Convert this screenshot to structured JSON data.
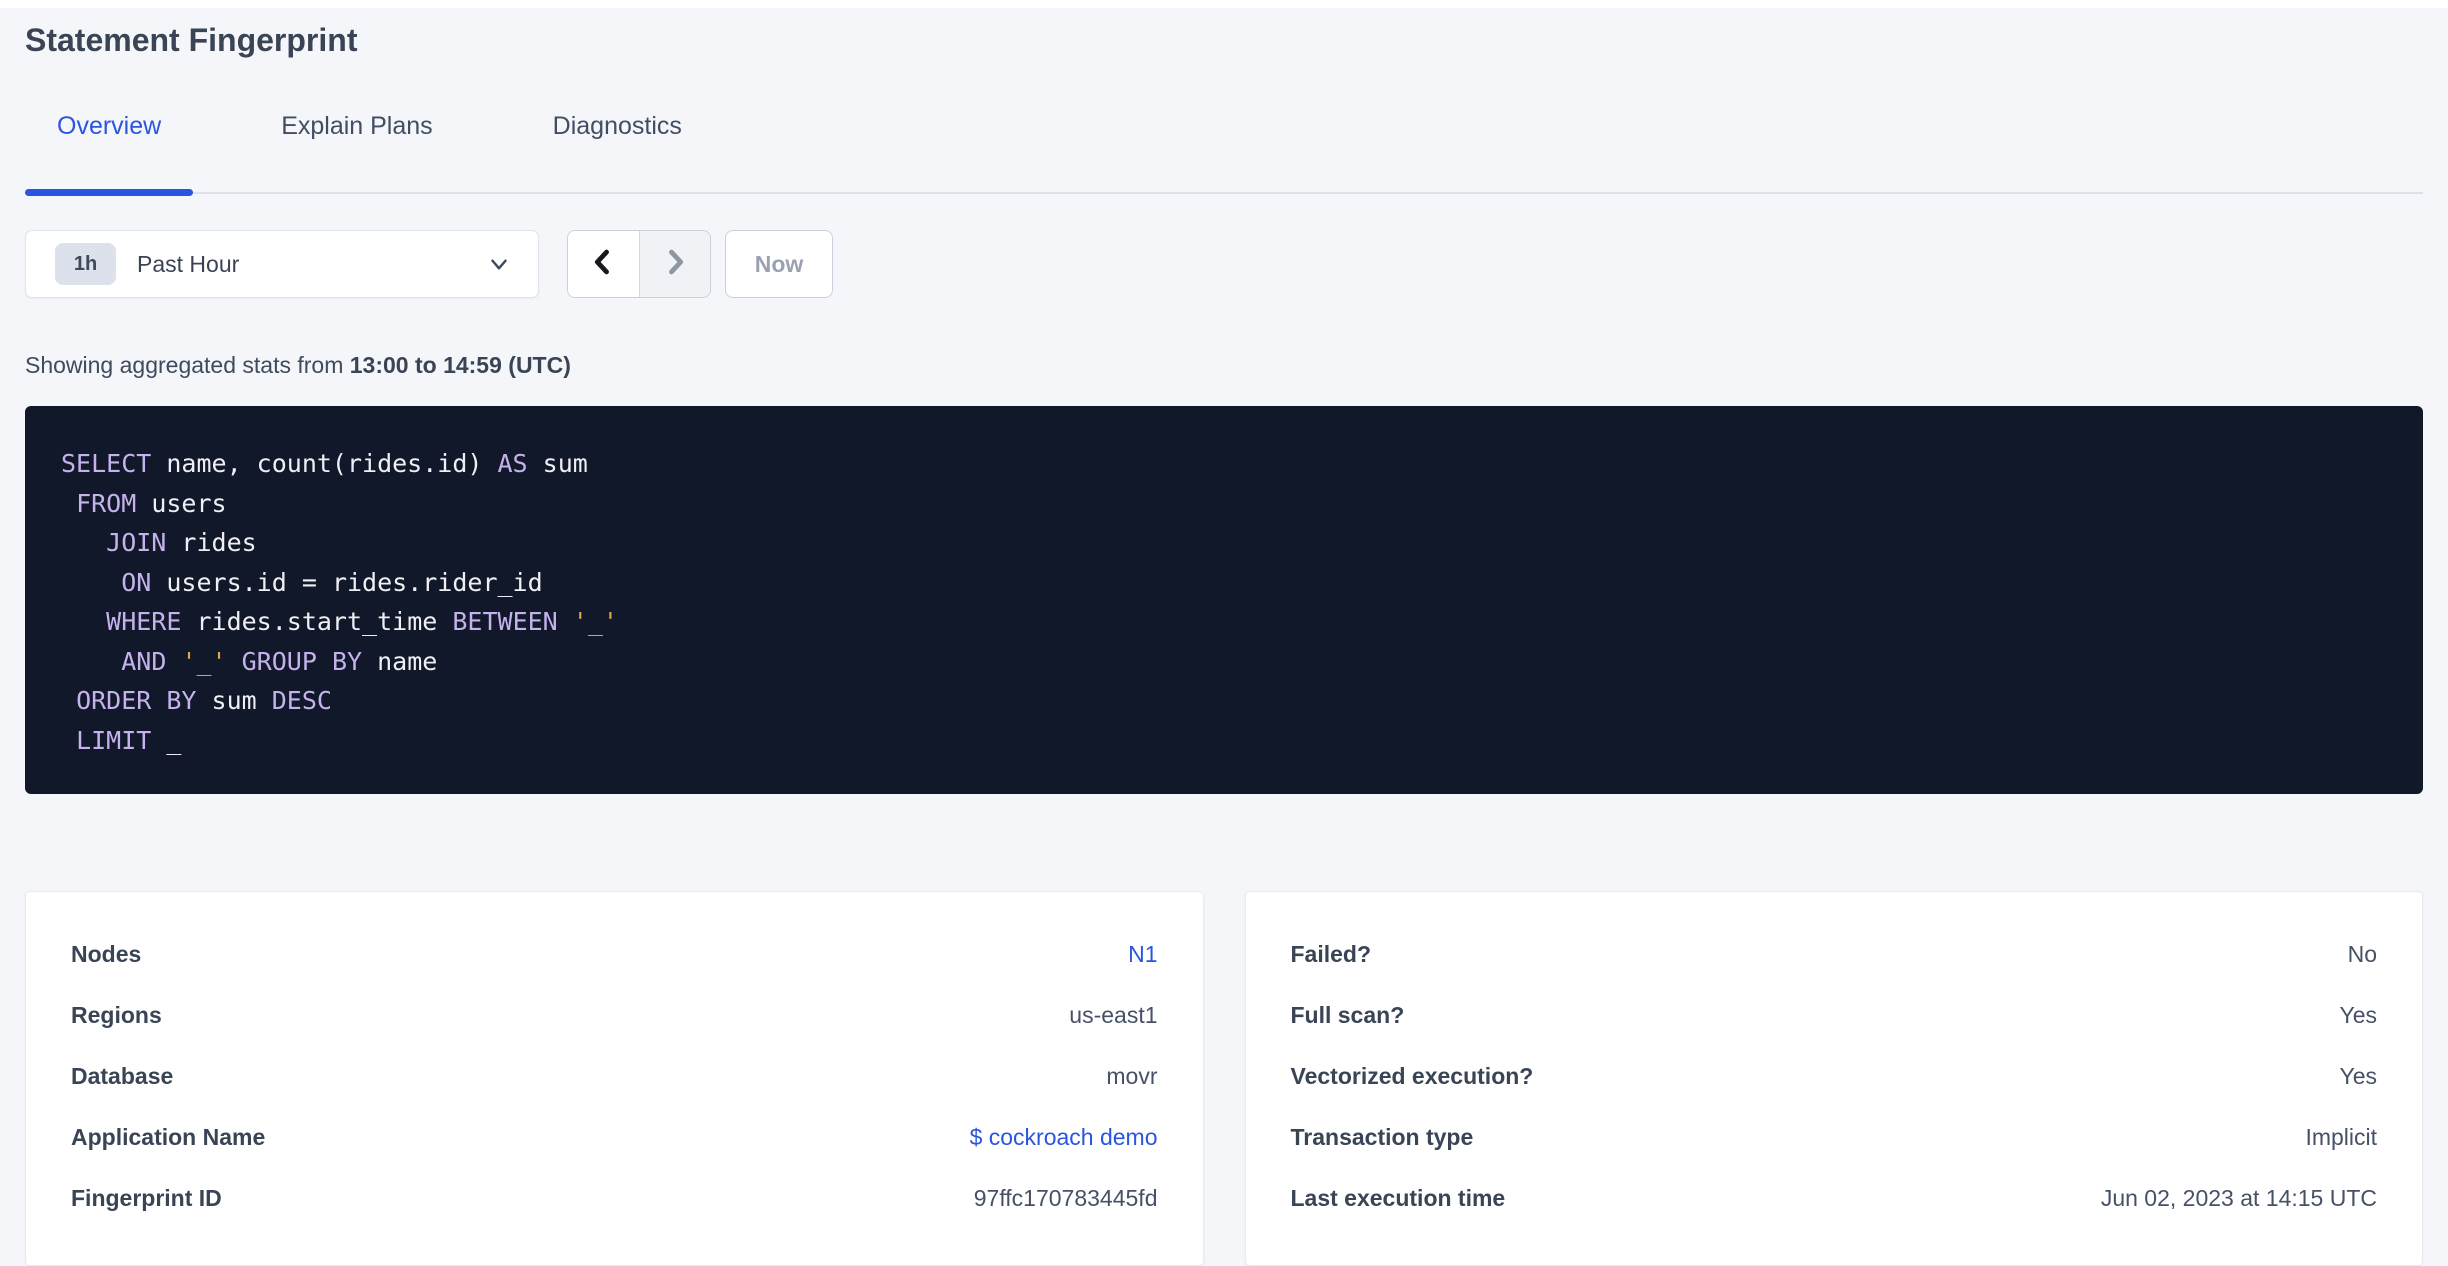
{
  "page": {
    "title": "Statement Fingerprint"
  },
  "tabs": [
    {
      "label": "Overview",
      "active": true
    },
    {
      "label": "Explain Plans",
      "active": false
    },
    {
      "label": "Diagnostics",
      "active": false
    }
  ],
  "time_picker": {
    "interval_badge": "1h",
    "selected_label": "Past Hour",
    "now_label": "Now",
    "dropdown_icon": "chevron-down",
    "prev_icon": "chevron-left",
    "next_icon": "chevron-right"
  },
  "stats_line": {
    "prefix": "Showing aggregated stats from ",
    "range_bold": "13:00 to 14:59 (UTC)"
  },
  "sql": {
    "lines": [
      [
        {
          "t": "SELECT",
          "c": "kw"
        },
        {
          "t": " name, count(rides.id) ",
          "c": "pl"
        },
        {
          "t": "AS",
          "c": "kw"
        },
        {
          "t": " sum",
          "c": "pl"
        }
      ],
      [
        {
          "t": " ",
          "c": "pl"
        },
        {
          "t": "FROM",
          "c": "kw"
        },
        {
          "t": " users",
          "c": "pl"
        }
      ],
      [
        {
          "t": "   ",
          "c": "pl"
        },
        {
          "t": "JOIN",
          "c": "kw"
        },
        {
          "t": " rides",
          "c": "pl"
        }
      ],
      [
        {
          "t": "    ",
          "c": "pl"
        },
        {
          "t": "ON",
          "c": "kw"
        },
        {
          "t": " users.id = rides.rider_id",
          "c": "pl"
        }
      ],
      [
        {
          "t": "   ",
          "c": "pl"
        },
        {
          "t": "WHERE",
          "c": "kw"
        },
        {
          "t": " rides.start_time ",
          "c": "pl"
        },
        {
          "t": "BETWEEN",
          "c": "kw"
        },
        {
          "t": " ",
          "c": "pl"
        },
        {
          "t": "'_'",
          "c": "lit"
        }
      ],
      [
        {
          "t": "    ",
          "c": "pl"
        },
        {
          "t": "AND",
          "c": "kw"
        },
        {
          "t": " ",
          "c": "pl"
        },
        {
          "t": "'_'",
          "c": "lit"
        },
        {
          "t": " ",
          "c": "pl"
        },
        {
          "t": "GROUP BY",
          "c": "kw"
        },
        {
          "t": " name",
          "c": "pl"
        }
      ],
      [
        {
          "t": " ",
          "c": "pl"
        },
        {
          "t": "ORDER BY",
          "c": "kw"
        },
        {
          "t": " sum ",
          "c": "pl"
        },
        {
          "t": "DESC",
          "c": "kw"
        }
      ],
      [
        {
          "t": " ",
          "c": "pl"
        },
        {
          "t": "LIMIT",
          "c": "kw"
        },
        {
          "t": " _",
          "c": "pl"
        }
      ]
    ]
  },
  "cards": {
    "left": {
      "rows": [
        {
          "label": "Nodes",
          "value": "N1",
          "link": true
        },
        {
          "label": "Regions",
          "value": "us-east1",
          "link": false
        },
        {
          "label": "Database",
          "value": "movr",
          "link": false
        },
        {
          "label": "Application Name",
          "value": "$ cockroach demo",
          "link": true
        },
        {
          "label": "Fingerprint ID",
          "value": "97ffc170783445fd",
          "link": false
        }
      ]
    },
    "right": {
      "rows": [
        {
          "label": "Failed?",
          "value": "No",
          "link": false
        },
        {
          "label": "Full scan?",
          "value": "Yes",
          "link": false
        },
        {
          "label": "Vectorized execution?",
          "value": "Yes",
          "link": false
        },
        {
          "label": "Transaction type",
          "value": "Implicit",
          "link": false
        },
        {
          "label": "Last execution time",
          "value": "Jun 02, 2023 at 14:15 UTC",
          "link": false
        }
      ]
    }
  },
  "colors": {
    "accent_blue": "#2A55E0",
    "page_bg": "#F5F6FA",
    "code_bg": "#111829",
    "code_keyword": "#C5B2EC",
    "code_literal": "#E8A254",
    "code_text": "#EFEFF4",
    "title_text": "#394455"
  }
}
